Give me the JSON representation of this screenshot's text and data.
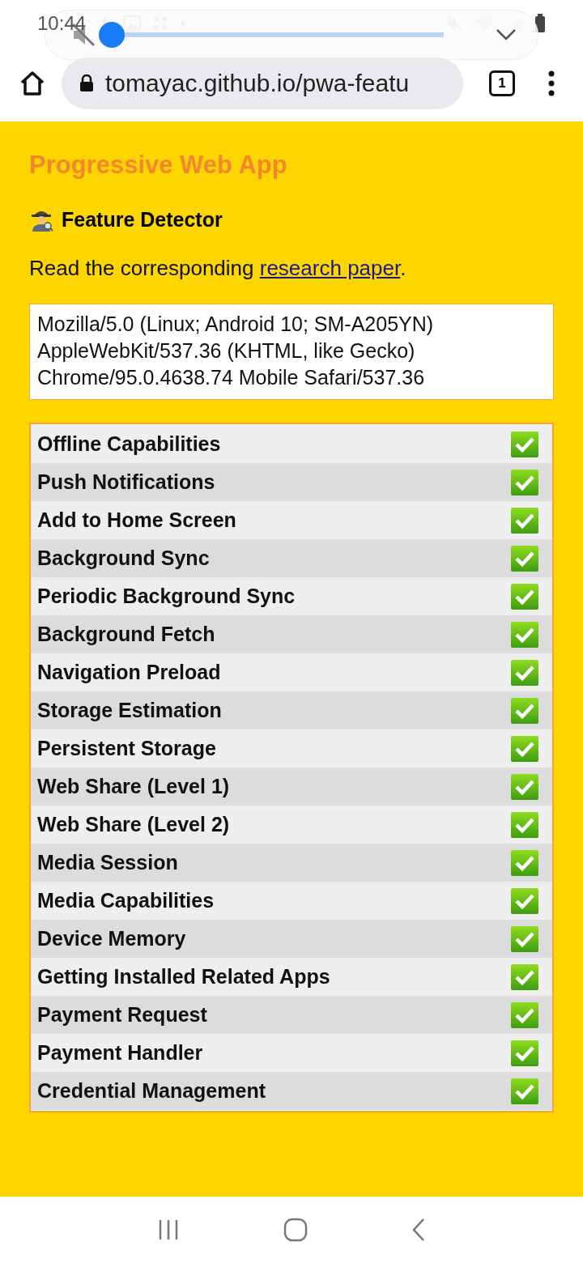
{
  "status_bar": {
    "time": "10:44"
  },
  "volume_panel": {
    "muted": true,
    "level": 0.0
  },
  "browser": {
    "url": "tomayac.github.io/pwa-featu",
    "tab_count": "1"
  },
  "page": {
    "title": "Progressive Web App",
    "subtitle": "Feature Detector",
    "intro": "Read the corresponding ",
    "link": "research paper",
    "intro_end": ".",
    "user_agent": [
      "Mozilla/5.0 (Linux; Android 10; SM-A205YN)",
      "AppleWebKit/537.36 (KHTML, like Gecko)",
      "Chrome/95.0.4638.74 Mobile Safari/537.36"
    ]
  },
  "features": [
    {
      "name": "Offline Capabilities",
      "supported": true
    },
    {
      "name": "Push Notifications",
      "supported": true
    },
    {
      "name": "Add to Home Screen",
      "supported": true
    },
    {
      "name": "Background Sync",
      "supported": true
    },
    {
      "name": "Periodic Background Sync",
      "supported": true
    },
    {
      "name": "Background Fetch",
      "supported": true
    },
    {
      "name": "Navigation Preload",
      "supported": true
    },
    {
      "name": "Storage Estimation",
      "supported": true
    },
    {
      "name": "Persistent Storage",
      "supported": true
    },
    {
      "name": "Web Share (Level 1)",
      "supported": true
    },
    {
      "name": "Web Share (Level 2)",
      "supported": true
    },
    {
      "name": "Media Session",
      "supported": true
    },
    {
      "name": "Media Capabilities",
      "supported": true
    },
    {
      "name": "Device Memory",
      "supported": true
    },
    {
      "name": "Getting Installed Related Apps",
      "supported": true
    },
    {
      "name": "Payment Request",
      "supported": true
    },
    {
      "name": "Payment Handler",
      "supported": true
    },
    {
      "name": "Credential Management",
      "supported": true
    }
  ]
}
